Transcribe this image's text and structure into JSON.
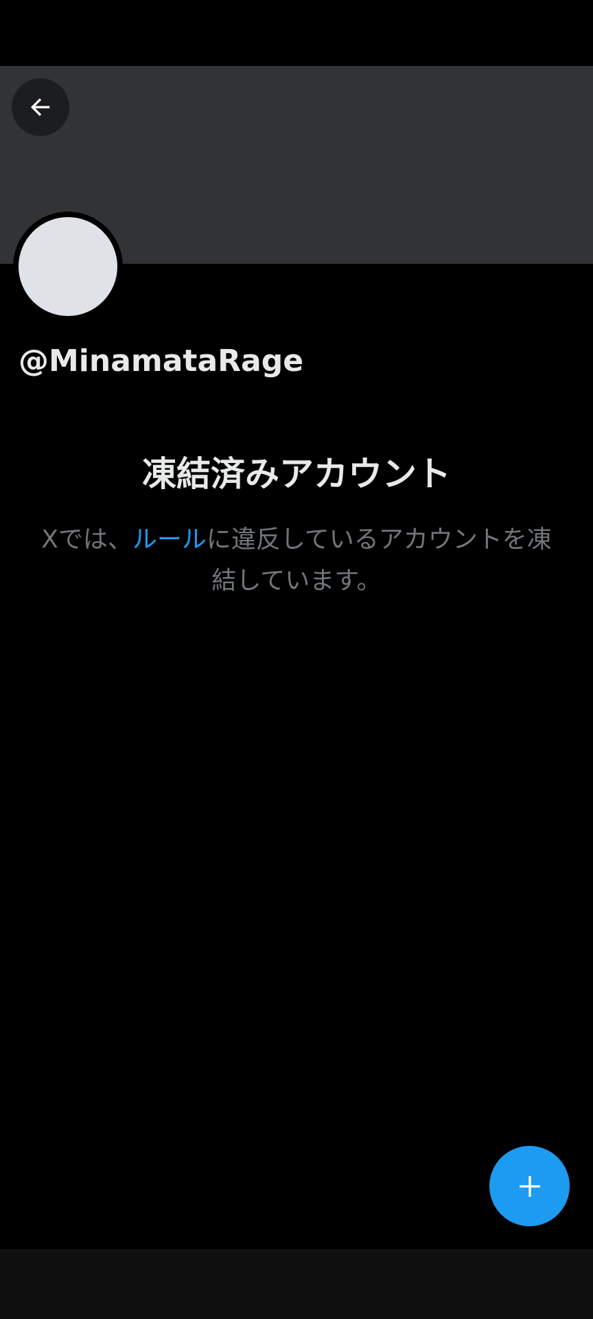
{
  "profile": {
    "handle": "@MinamataRage"
  },
  "suspended": {
    "title": "凍結済みアカウント",
    "message_prefix": "Xでは、",
    "rules_link": "ルール",
    "message_suffix": "に違反しているアカウントを凍結しています。"
  },
  "icons": {
    "back": "arrow-left-icon",
    "compose": "plus-icon"
  },
  "colors": {
    "background": "#000000",
    "banner": "#313335",
    "avatar": "#dfe3e8",
    "accent": "#1d9bf0",
    "secondary_text": "#71767b",
    "primary_text": "#e7e9ea"
  }
}
